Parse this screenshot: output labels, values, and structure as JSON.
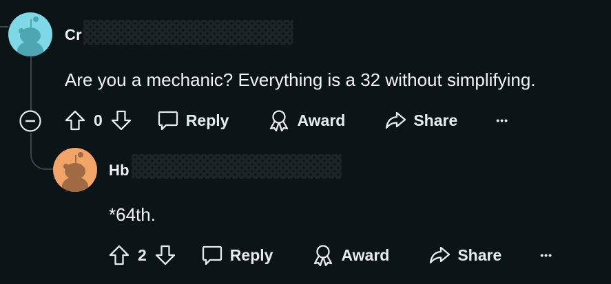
{
  "comments": [
    {
      "username": "Cr",
      "avatar_color": "#7fd8e6",
      "avatar_figure_color": "#4ea6b3",
      "text": "Are you a mechanic?  Everything is a 32 without simplifying.",
      "score": "0",
      "actions": {
        "reply": "Reply",
        "award": "Award",
        "share": "Share",
        "more": "•••"
      }
    },
    {
      "username": "Hb",
      "avatar_color": "#f1a468",
      "avatar_figure_color": "#a06a45",
      "text": "*64th.",
      "score": "2",
      "actions": {
        "reply": "Reply",
        "award": "Award",
        "share": "Share",
        "more": "•••"
      }
    }
  ],
  "icons": {
    "collapse": "minus-circle-icon",
    "upvote": "arrow-up-icon",
    "downvote": "arrow-down-icon",
    "reply": "speech-bubble-icon",
    "award": "award-ribbon-icon",
    "share": "share-arrow-icon"
  },
  "colors": {
    "background": "#0b1416",
    "text": "#f2f4f5",
    "thread_line": "#3a4548"
  }
}
